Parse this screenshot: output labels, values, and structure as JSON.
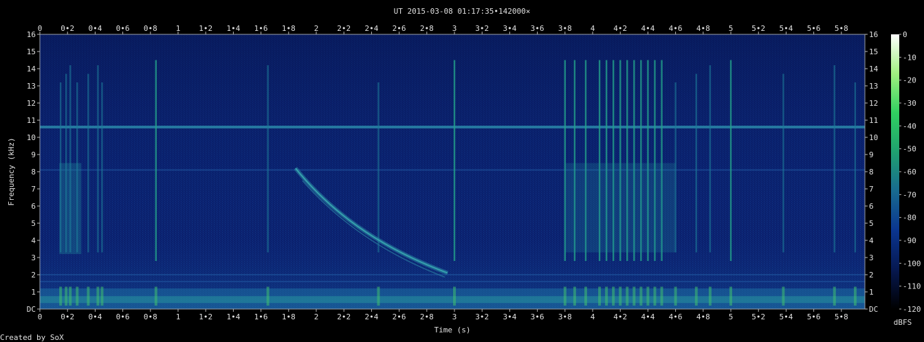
{
  "chart_data": {
    "type": "heatmap",
    "title": "UT 2015-03-08 01:17:35•142000×",
    "xlabel": "Time (s)",
    "ylabel": "Frequency (kHz)",
    "xlim": [
      0,
      5.97
    ],
    "ylim": [
      0,
      16
    ],
    "x_ticks": [
      "0",
      "0•2",
      "0•4",
      "0•6",
      "0•8",
      "1",
      "1•2",
      "1•4",
      "1•6",
      "1•8",
      "2",
      "2•2",
      "2•4",
      "2•6",
      "2•8",
      "3",
      "3•2",
      "3•4",
      "3•6",
      "3•8",
      "4",
      "4•2",
      "4•4",
      "4•6",
      "4•8",
      "5",
      "5•2",
      "5•4",
      "5•6",
      "5•8"
    ],
    "y_ticks": [
      "DC",
      "1",
      "2",
      "3",
      "4",
      "5",
      "6",
      "7",
      "8",
      "9",
      "10",
      "11",
      "12",
      "13",
      "14",
      "15",
      "16"
    ],
    "colorbar": {
      "label": "dBFS",
      "range": [
        -120,
        0
      ],
      "ticks": [
        "0",
        "-10",
        "-20",
        "-30",
        "-40",
        "-50",
        "-60",
        "-70",
        "-80",
        "-90",
        "-100",
        "-110",
        "-120"
      ],
      "colors": [
        "#000000",
        "#061850",
        "#0a3590",
        "#186a90",
        "#1fa070",
        "#30d060",
        "#a0f080",
        "#ffffff"
      ]
    },
    "background_color": "#0a1e6a",
    "features": {
      "hum_line_khz": 10.6,
      "sweep": {
        "start": [
          1.85,
          8.2
        ],
        "end": [
          2.95,
          2.1
        ]
      },
      "impulses_s": [
        0.15,
        0.19,
        0.22,
        0.27,
        0.35,
        0.42,
        0.45,
        0.84,
        1.65,
        2.45,
        3.0,
        3.8,
        3.87,
        3.95,
        4.05,
        4.1,
        4.15,
        4.2,
        4.25,
        4.3,
        4.35,
        4.4,
        4.45,
        4.5,
        4.6,
        4.75,
        4.85,
        5.0,
        5.38,
        5.75,
        5.9
      ]
    }
  },
  "footer": {
    "credit": "Created by SoX"
  }
}
